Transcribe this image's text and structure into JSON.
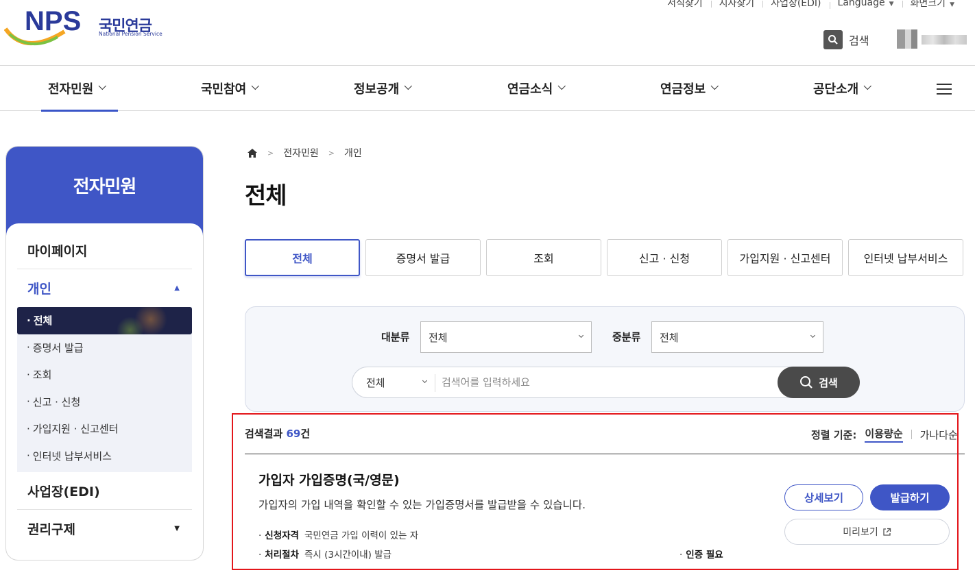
{
  "header": {
    "logo_en": "NPS",
    "logo_ko": "국민연금",
    "logo_sub": "National Pension Service",
    "util": [
      {
        "label": "서식찾기",
        "caret": false
      },
      {
        "label": "지사찾기",
        "caret": false
      },
      {
        "label": "사업장(EDI)",
        "caret": false
      },
      {
        "label": "Language",
        "caret": true
      },
      {
        "label": "화면크기",
        "caret": true
      }
    ],
    "search_label": "검색"
  },
  "gnb": [
    "전자민원",
    "국민참여",
    "정보공개",
    "연금소식",
    "연금정보",
    "공단소개"
  ],
  "lnb": {
    "title": "전자민원",
    "mypage": "마이페이지",
    "personal": "개인",
    "subs": [
      "전체",
      "증명서 발급",
      "조회",
      "신고 · 신청",
      "가입지원 · 신고센터",
      "인터넷 납부서비스"
    ],
    "biz": "사업장(EDI)",
    "rights": "권리구제"
  },
  "breadcrumb": [
    "전자민원",
    "개인"
  ],
  "page_title": "전체",
  "tabs": [
    "전체",
    "증명서 발급",
    "조회",
    "신고 · 신청",
    "가입지원 · 신고센터",
    "인터넷 납부서비스"
  ],
  "filter": {
    "major_label": "대분류",
    "major_value": "전체",
    "minor_label": "중분류",
    "minor_value": "전체",
    "scope_value": "전체",
    "placeholder": "검색어를 입력하세요",
    "search_button": "검색"
  },
  "results": {
    "prefix": "검색결과 ",
    "count": "69",
    "suffix": "건",
    "sort_label": "정렬 기준:",
    "sort_opt1": "이용량순",
    "sort_opt2": "가나다순"
  },
  "item": {
    "title": "가입자 가입증명(국/영문)",
    "desc": "가입자의 가입 내역을 확인할 수 있는 가입증명서를 발급받을 수 있습니다.",
    "qual_label": "신청자격",
    "qual_value": "국민연금 가입 이력이 있는 자",
    "proc_label": "처리절차",
    "proc_value": "즉시 (3시간이내) 발급",
    "auth": "인증 필요",
    "btn_detail": "상세보기",
    "btn_issue": "발급하기",
    "btn_preview": "미리보기"
  },
  "colors": {
    "accent": "#3f56c6",
    "dark": "#1e2348",
    "highlight": "#e3161b"
  }
}
